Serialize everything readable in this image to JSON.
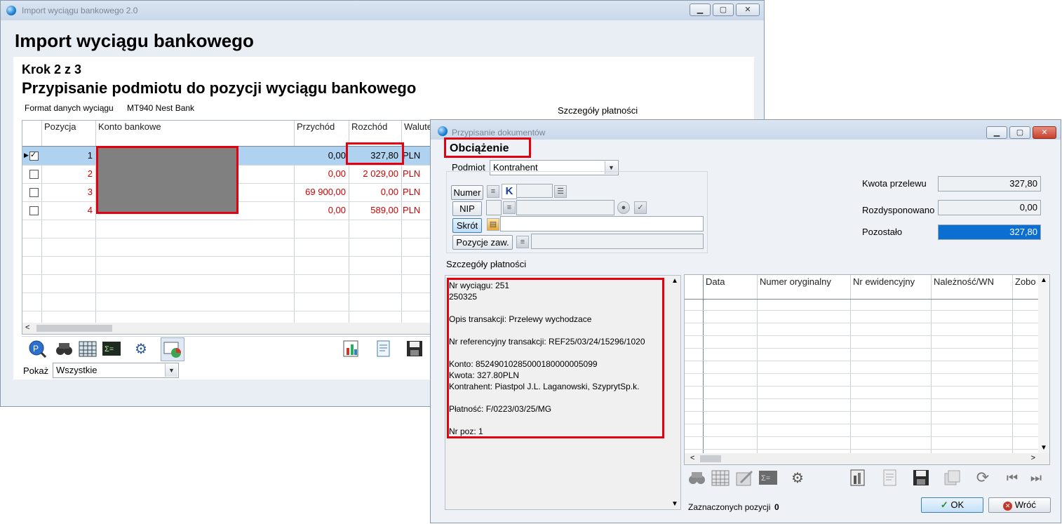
{
  "main_window": {
    "title": "Import wyciągu bankowego 2.0",
    "header": "Import wyciągu bankowego",
    "step": "Krok 2 z 3",
    "subtitle": "Przypisanie podmiotu do pozycji wyciągu bankowego",
    "format_label": "Format danych wyciągu",
    "format_value": "MT940 Nest Bank",
    "details_label": "Szczegóły płatności",
    "columns": [
      "Pozycja",
      "Konto bankowe",
      "Przychód",
      "Rozchód",
      "Walute"
    ],
    "rows": [
      {
        "pos": "1",
        "przychod": "0,00",
        "rozchod": "327,80",
        "waluta": "PLN",
        "checked": true
      },
      {
        "pos": "2",
        "przychod": "0,00",
        "rozchod": "2 029,00",
        "waluta": "PLN",
        "checked": false
      },
      {
        "pos": "3",
        "przychod": "69 900,00",
        "rozchod": "0,00",
        "waluta": "PLN",
        "checked": false
      },
      {
        "pos": "4",
        "przychod": "0,00",
        "rozchod": "589,00",
        "waluta": "PLN",
        "checked": false
      }
    ],
    "show_label": "Pokaż",
    "show_value": "Wszystkie"
  },
  "dialog": {
    "title": "Przypisanie dokumentów",
    "heading": "Obciążenie",
    "podmiot_label": "Podmiot",
    "podmiot_value": "Kontrahent",
    "numer_btn": "Numer",
    "k_label": "K",
    "nip_btn": "NIP",
    "skrot_btn": "Skrót",
    "pozycje_btn": "Pozycje zaw.",
    "kwota_label": "Kwota przelewu",
    "kwota_value": "327,80",
    "rozdysponowano_label": "Rozdysponowano",
    "rozdysponowano_value": "0,00",
    "pozostalo_label": "Pozostało",
    "pozostalo_value": "327,80",
    "details_label": "Szczegóły płatności",
    "details_lines": [
      "Nr wyciągu: 251",
      "250325",
      "",
      "Opis transakcji: Przelewy wychodzace",
      "",
      "Nr referencyjny transakcji: REF25/03/24/15296/1020",
      "",
      "Konto: 85249010285000180000005099",
      "Kwota: 327.80PLN",
      "Kontrahent: Piastpol J.L. Laganowski, SzyprytSp.k.",
      "",
      "Płatność: F/0223/03/25/MG",
      "",
      "Nr poz: 1"
    ],
    "columns": [
      "Data",
      "Numer oryginalny",
      "Nr ewidencyjny",
      "Należność/WN",
      "Zobo"
    ],
    "selected_label": "Zaznaczonych pozycji",
    "selected_count": "0",
    "ok_label": "OK",
    "back_label": "Wróć"
  }
}
